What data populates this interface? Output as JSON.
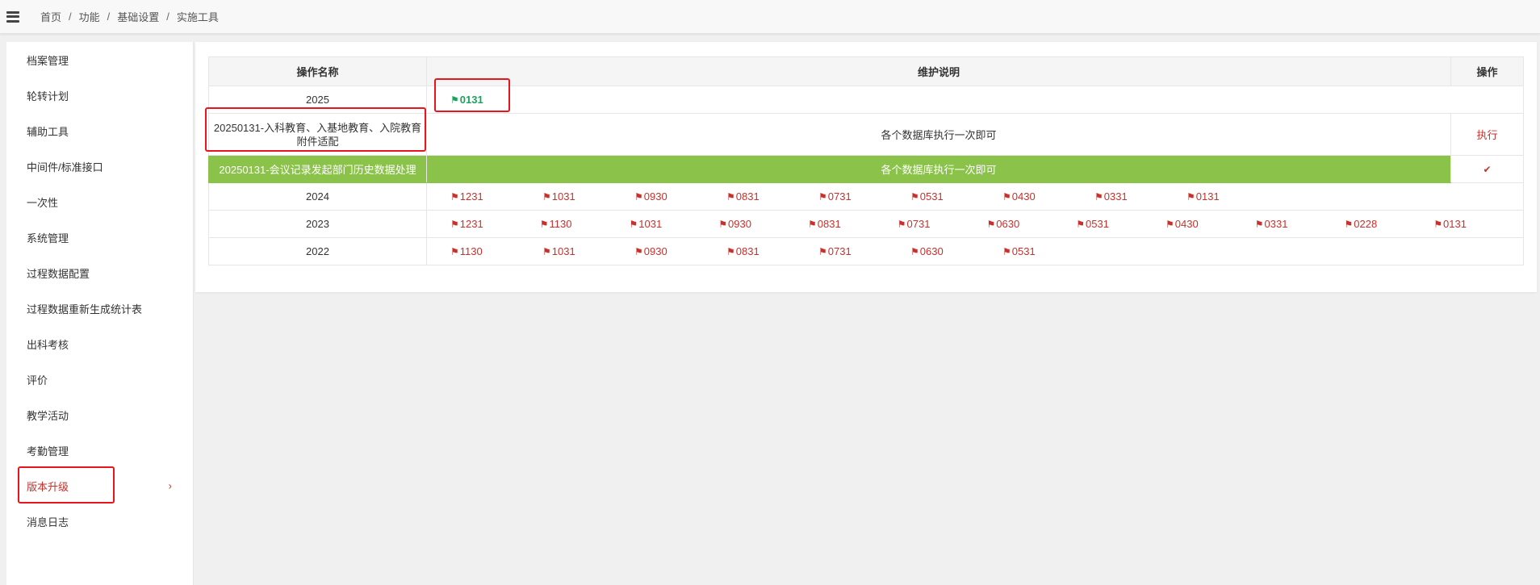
{
  "breadcrumb": [
    "首页",
    "功能",
    "基础设置",
    "实施工具"
  ],
  "sidebar": {
    "items": [
      {
        "label": "档案管理"
      },
      {
        "label": "轮转计划"
      },
      {
        "label": "辅助工具"
      },
      {
        "label": "中间件/标准接口"
      },
      {
        "label": "一次性"
      },
      {
        "label": "系统管理"
      },
      {
        "label": "过程数据配置"
      },
      {
        "label": "过程数据重新生成统计表"
      },
      {
        "label": "出科考核"
      },
      {
        "label": "评价"
      },
      {
        "label": "教学活动"
      },
      {
        "label": "考勤管理"
      },
      {
        "label": "版本升级",
        "active": true
      },
      {
        "label": "消息日志"
      }
    ],
    "active_chevron": "chevron-right-icon"
  },
  "table": {
    "headers": {
      "name": "操作名称",
      "desc": "维护说明",
      "op": "操作"
    },
    "rows": {
      "r2025": {
        "name": "2025",
        "versions": [
          "0131"
        ]
      },
      "adapt": {
        "name": "20250131-入科教育、入基地教育、入院教育附件适配",
        "desc": "各个数据库执行一次即可",
        "op": "执行"
      },
      "meeting": {
        "name": "20250131-会议记录发起部门历史数据处理",
        "desc": "各个数据库执行一次即可",
        "op_icon": "check-icon"
      },
      "r2024": {
        "name": "2024",
        "versions": [
          "1231",
          "1031",
          "0930",
          "0831",
          "0731",
          "0531",
          "0430",
          "0331",
          "0131"
        ]
      },
      "r2023": {
        "name": "2023",
        "versions": [
          "1231",
          "1130",
          "1031",
          "0930",
          "0831",
          "0731",
          "0630",
          "0531",
          "0430",
          "0331",
          "0228",
          "0131"
        ]
      },
      "r2022": {
        "name": "2022",
        "versions": [
          "1130",
          "1031",
          "0930",
          "0831",
          "0731",
          "0630",
          "0531"
        ]
      }
    }
  },
  "colors": {
    "accent_red": "#c9302c",
    "highlight_green": "#8bc34a",
    "new_version_green": "#1aa35b",
    "annotation_box": "#e8141e"
  }
}
